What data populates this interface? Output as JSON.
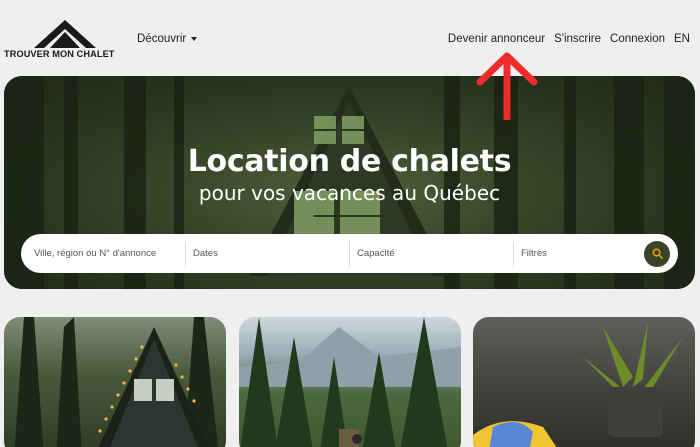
{
  "brand": {
    "logo_text": "TROUVER MON CHALET"
  },
  "nav": {
    "discover_label": "Découvrir",
    "right_links": [
      "Devenir annonceur",
      "S'inscrire",
      "Connexion",
      "EN"
    ]
  },
  "hero": {
    "title": "Location de chalets",
    "subtitle": "pour vos vacances au Québec"
  },
  "search": {
    "location_placeholder": "Ville, région ou N° d'annonce",
    "dates_placeholder": "Dates",
    "capacity_placeholder": "Capacité",
    "filters_placeholder": "Filtres"
  },
  "colors": {
    "accent_dark_green": "#3a4327",
    "search_icon": "#e0a800",
    "annotation_red": "#ee2c2c"
  },
  "icons": {
    "search": "search-icon",
    "caret": "chevron-down-icon"
  }
}
